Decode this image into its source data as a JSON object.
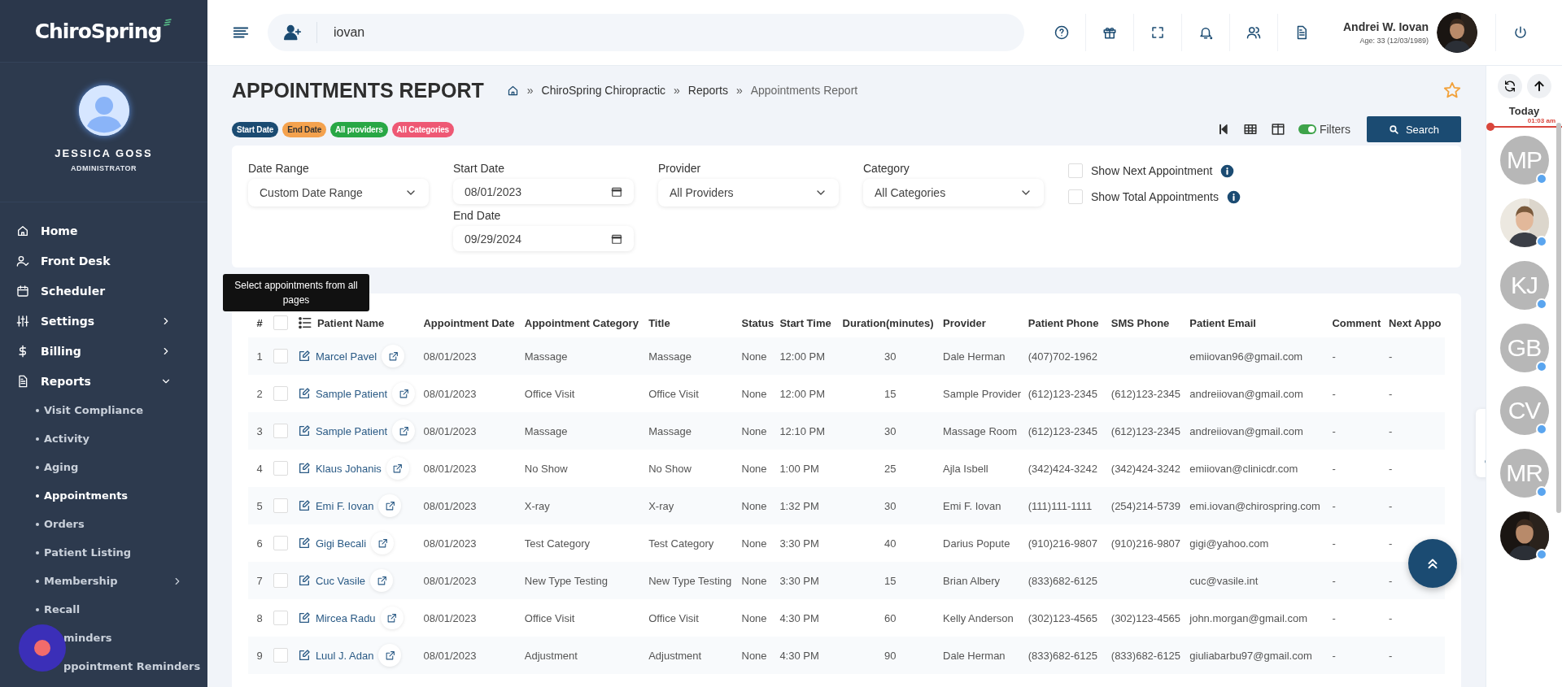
{
  "sidebar": {
    "logo": "ChiroSpring",
    "user_name": "JESSICA GOSS",
    "user_role": "ADMINISTRATOR",
    "items": [
      {
        "label": "Home"
      },
      {
        "label": "Front Desk"
      },
      {
        "label": "Scheduler"
      },
      {
        "label": "Settings",
        "expanded": false
      },
      {
        "label": "Billing",
        "expanded": false
      },
      {
        "label": "Reports",
        "expanded": true,
        "children": [
          {
            "label": "Visit Compliance",
            "selected": false
          },
          {
            "label": "Activity",
            "selected": false
          },
          {
            "label": "Aging",
            "selected": false
          },
          {
            "label": "Appointments",
            "selected": true
          },
          {
            "label": "Orders",
            "selected": false
          },
          {
            "label": "Patient Listing",
            "selected": false
          },
          {
            "label": "Membership",
            "selected": false,
            "expanded": false
          },
          {
            "label": "Recall",
            "selected": false
          },
          {
            "label": "minders",
            "selected": false,
            "kind": "covered"
          },
          {
            "label": "ppointment Reminders",
            "selected": false,
            "kind": "covered"
          }
        ]
      }
    ]
  },
  "topbar": {
    "search_value": "iovan",
    "profile_name": "Andrei W. Iovan",
    "profile_age": "Age: 33 (12/03/1989)"
  },
  "header": {
    "title": "APPOINTMENTS REPORT",
    "separator": "»",
    "breadcrumb": [
      "ChiroSpring Chiropractic",
      "Reports",
      "Appointments Report"
    ],
    "favorite": false
  },
  "chips": [
    {
      "label": "Start Date",
      "color": "#1b4b72"
    },
    {
      "label": "End Date",
      "color": "#f4a24e"
    },
    {
      "label": "All providers",
      "color": "#28a745"
    },
    {
      "label": "All Categories",
      "color": "#ee5874"
    }
  ],
  "toolbar": {
    "filters_label": "Filters",
    "filters_on": true,
    "search_label": "Search"
  },
  "filters": {
    "date_range": {
      "label": "Date Range",
      "value": "Custom Date Range"
    },
    "start_date": {
      "label": "Start Date",
      "value": "08/01/2023"
    },
    "end_date": {
      "label": "End Date",
      "value": "09/29/2024"
    },
    "provider": {
      "label": "Provider",
      "value": "All Providers"
    },
    "category": {
      "label": "Category",
      "value": "All Categories"
    },
    "options": [
      {
        "label": "Show Next Appointment",
        "checked": false
      },
      {
        "label": "Show Total Appointments",
        "checked": false
      }
    ]
  },
  "tooltip": "Select appointments from all pages",
  "table": {
    "select_all": false,
    "columns": [
      "#",
      "Patient Name",
      "Appointment Date",
      "Appointment Category",
      "Title",
      "Status",
      "Start Time",
      "Duration(minutes)",
      "Provider",
      "Patient Phone",
      "SMS Phone",
      "Patient Email",
      "Comment",
      "Next Appo"
    ],
    "rows": [
      {
        "selected": false,
        "cells": [
          "1",
          "Marcel Pavel",
          "08/01/2023",
          "Massage",
          "Massage",
          "None",
          "12:00 PM",
          "30",
          "Dale Herman",
          "(407)702-1962",
          "",
          "emiiovan96@gmail.com",
          "-",
          "-"
        ]
      },
      {
        "selected": false,
        "cells": [
          "2",
          "Sample Patient",
          "08/01/2023",
          "Office Visit",
          "Office Visit",
          "None",
          "12:00 PM",
          "15",
          "Sample Provider",
          "(612)123-2345",
          "(612)123-2345",
          "andreiiovan@gmail.com",
          "-",
          "-"
        ]
      },
      {
        "selected": false,
        "cells": [
          "3",
          "Sample Patient",
          "08/01/2023",
          "Massage",
          "Massage",
          "None",
          "12:10 PM",
          "30",
          "Massage Room",
          "(612)123-2345",
          "(612)123-2345",
          "andreiiovan@gmail.com",
          "-",
          "-"
        ]
      },
      {
        "selected": false,
        "cells": [
          "4",
          "Klaus Johanis",
          "08/01/2023",
          "No Show",
          "No Show",
          "None",
          "1:00 PM",
          "25",
          "Ajla Isbell",
          "(342)424-3242",
          "(342)424-3242",
          "emiiovan@clinicdr.com",
          "-",
          "-"
        ]
      },
      {
        "selected": false,
        "cells": [
          "5",
          "Emi F. Iovan",
          "08/01/2023",
          "X-ray",
          "X-ray",
          "None",
          "1:32 PM",
          "30",
          "Emi F. Iovan",
          "(111)111-1111",
          "(254)214-5739",
          "emi.iovan@chirospring.com",
          "-",
          "-"
        ]
      },
      {
        "selected": false,
        "cells": [
          "6",
          "Gigi Becali",
          "08/01/2023",
          "Test Category",
          "Test Category",
          "None",
          "3:30 PM",
          "40",
          "Darius Popute",
          "(910)216-9807",
          "(910)216-9807",
          "gigi@yahoo.com",
          "-",
          "-"
        ]
      },
      {
        "selected": false,
        "cells": [
          "7",
          "Cuc Vasile",
          "08/01/2023",
          "New Type Testing",
          "New Type Testing",
          "None",
          "3:30 PM",
          "15",
          "Brian Albery",
          "(833)682-6125",
          "",
          "cuc@vasile.int",
          "-",
          "-"
        ]
      },
      {
        "selected": false,
        "cells": [
          "8",
          "Mircea Radu",
          "08/01/2023",
          "Office Visit",
          "Office Visit",
          "None",
          "4:30 PM",
          "60",
          "Kelly Anderson",
          "(302)123-4565",
          "(302)123-4565",
          "john.morgan@gmail.com",
          "-",
          "-"
        ]
      },
      {
        "selected": false,
        "cells": [
          "9",
          "Luul J. Adan",
          "08/01/2023",
          "Adjustment",
          "Adjustment",
          "None",
          "4:30 PM",
          "90",
          "Dale Herman",
          "(833)682-6125",
          "(833)682-6125",
          "giuliabarbu97@gmail.com",
          "-",
          "-"
        ]
      }
    ]
  },
  "rail": {
    "today": "Today",
    "time": "01:03 am",
    "avatars": [
      {
        "kind": "initials",
        "initials": "MP"
      },
      {
        "kind": "picture"
      },
      {
        "kind": "initials",
        "initials": "KJ"
      },
      {
        "kind": "initials",
        "initials": "GB"
      },
      {
        "kind": "initials",
        "initials": "CV"
      },
      {
        "kind": "initials",
        "initials": "MR"
      },
      {
        "kind": "picture"
      }
    ]
  }
}
